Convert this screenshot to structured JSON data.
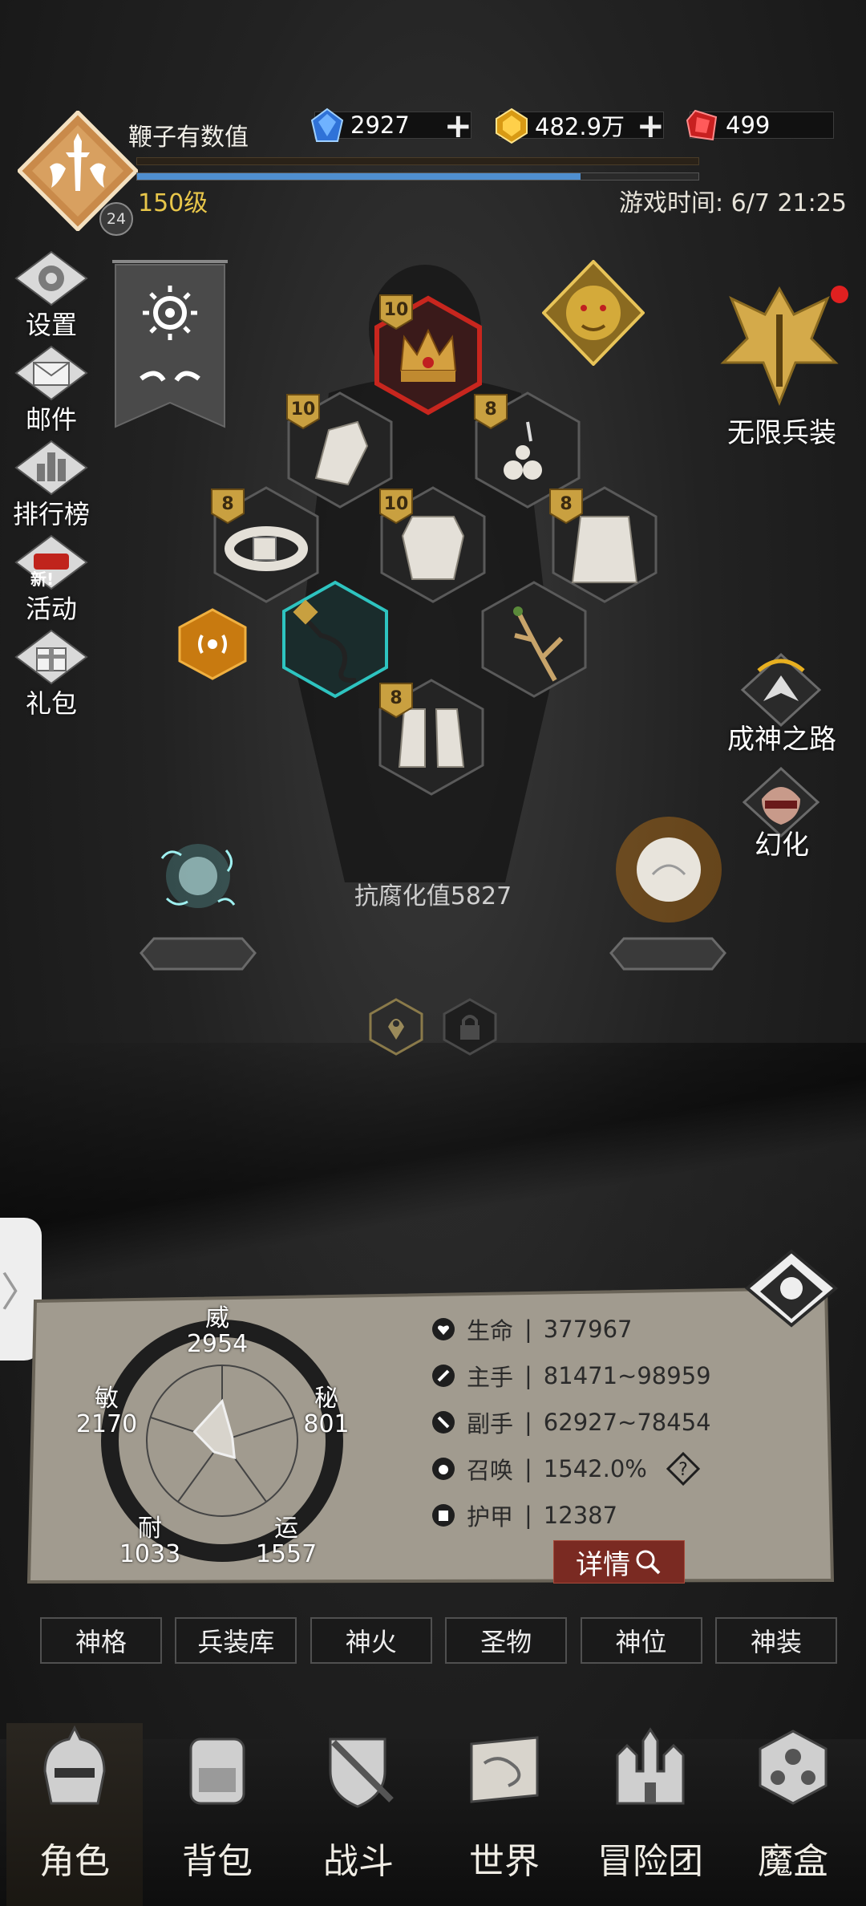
{
  "player": {
    "name": "鞭子有数值",
    "level_text": "150级",
    "badge_level": "24",
    "exp_fraction": 0.79
  },
  "game_time": "游戏时间: 6/7 21:25",
  "resources": [
    {
      "name": "blue-gem",
      "value": "2927",
      "has_plus": true,
      "color": "#3a8ee8"
    },
    {
      "name": "gold-gem",
      "value": "482.9万",
      "has_plus": true,
      "color": "#e8b020"
    },
    {
      "name": "red-gem",
      "value": "499",
      "has_plus": false,
      "color": "#d83030"
    }
  ],
  "left_menu": [
    {
      "label": "设置",
      "icon": "gear-icon"
    },
    {
      "label": "邮件",
      "icon": "mail-icon"
    },
    {
      "label": "排行榜",
      "icon": "ranking-icon"
    },
    {
      "label": "活动",
      "icon": "activity-icon",
      "badge": "新!"
    },
    {
      "label": "礼包",
      "icon": "gift-icon"
    }
  ],
  "right_menu": {
    "infinite_gear": "无限兵装",
    "godhood_path": "成神之路",
    "transform": "幻化"
  },
  "equipment": {
    "crown": "10",
    "gloves": "10",
    "necklace": "8",
    "belt": "8",
    "armor": "10",
    "cape": "8",
    "boots": "8"
  },
  "corruption_resistance": "抗腐化值5827",
  "stats": {
    "radar": {
      "wei": {
        "label": "威",
        "value": "2954"
      },
      "mi": {
        "label": "秘",
        "value": "801"
      },
      "yun": {
        "label": "运",
        "value": "1557"
      },
      "nai": {
        "label": "耐",
        "value": "1033"
      },
      "min": {
        "label": "敏",
        "value": "2170"
      }
    },
    "rows": [
      {
        "label": "生命",
        "value": "377967"
      },
      {
        "label": "主手",
        "value": "81471~98959"
      },
      {
        "label": "副手",
        "value": "62927~78454"
      },
      {
        "label": "召唤",
        "value": "1542.0%"
      },
      {
        "label": "护甲",
        "value": "12387"
      }
    ],
    "detail_button": "详情"
  },
  "tabs": [
    "神格",
    "兵装库",
    "神火",
    "圣物",
    "神位",
    "神装"
  ],
  "bottom_nav": [
    {
      "label": "角色",
      "active": true
    },
    {
      "label": "背包",
      "active": false
    },
    {
      "label": "战斗",
      "active": false
    },
    {
      "label": "世界",
      "active": false
    },
    {
      "label": "冒险团",
      "active": false
    },
    {
      "label": "魔盒",
      "active": false
    }
  ],
  "side_tab_glyph": "〉"
}
